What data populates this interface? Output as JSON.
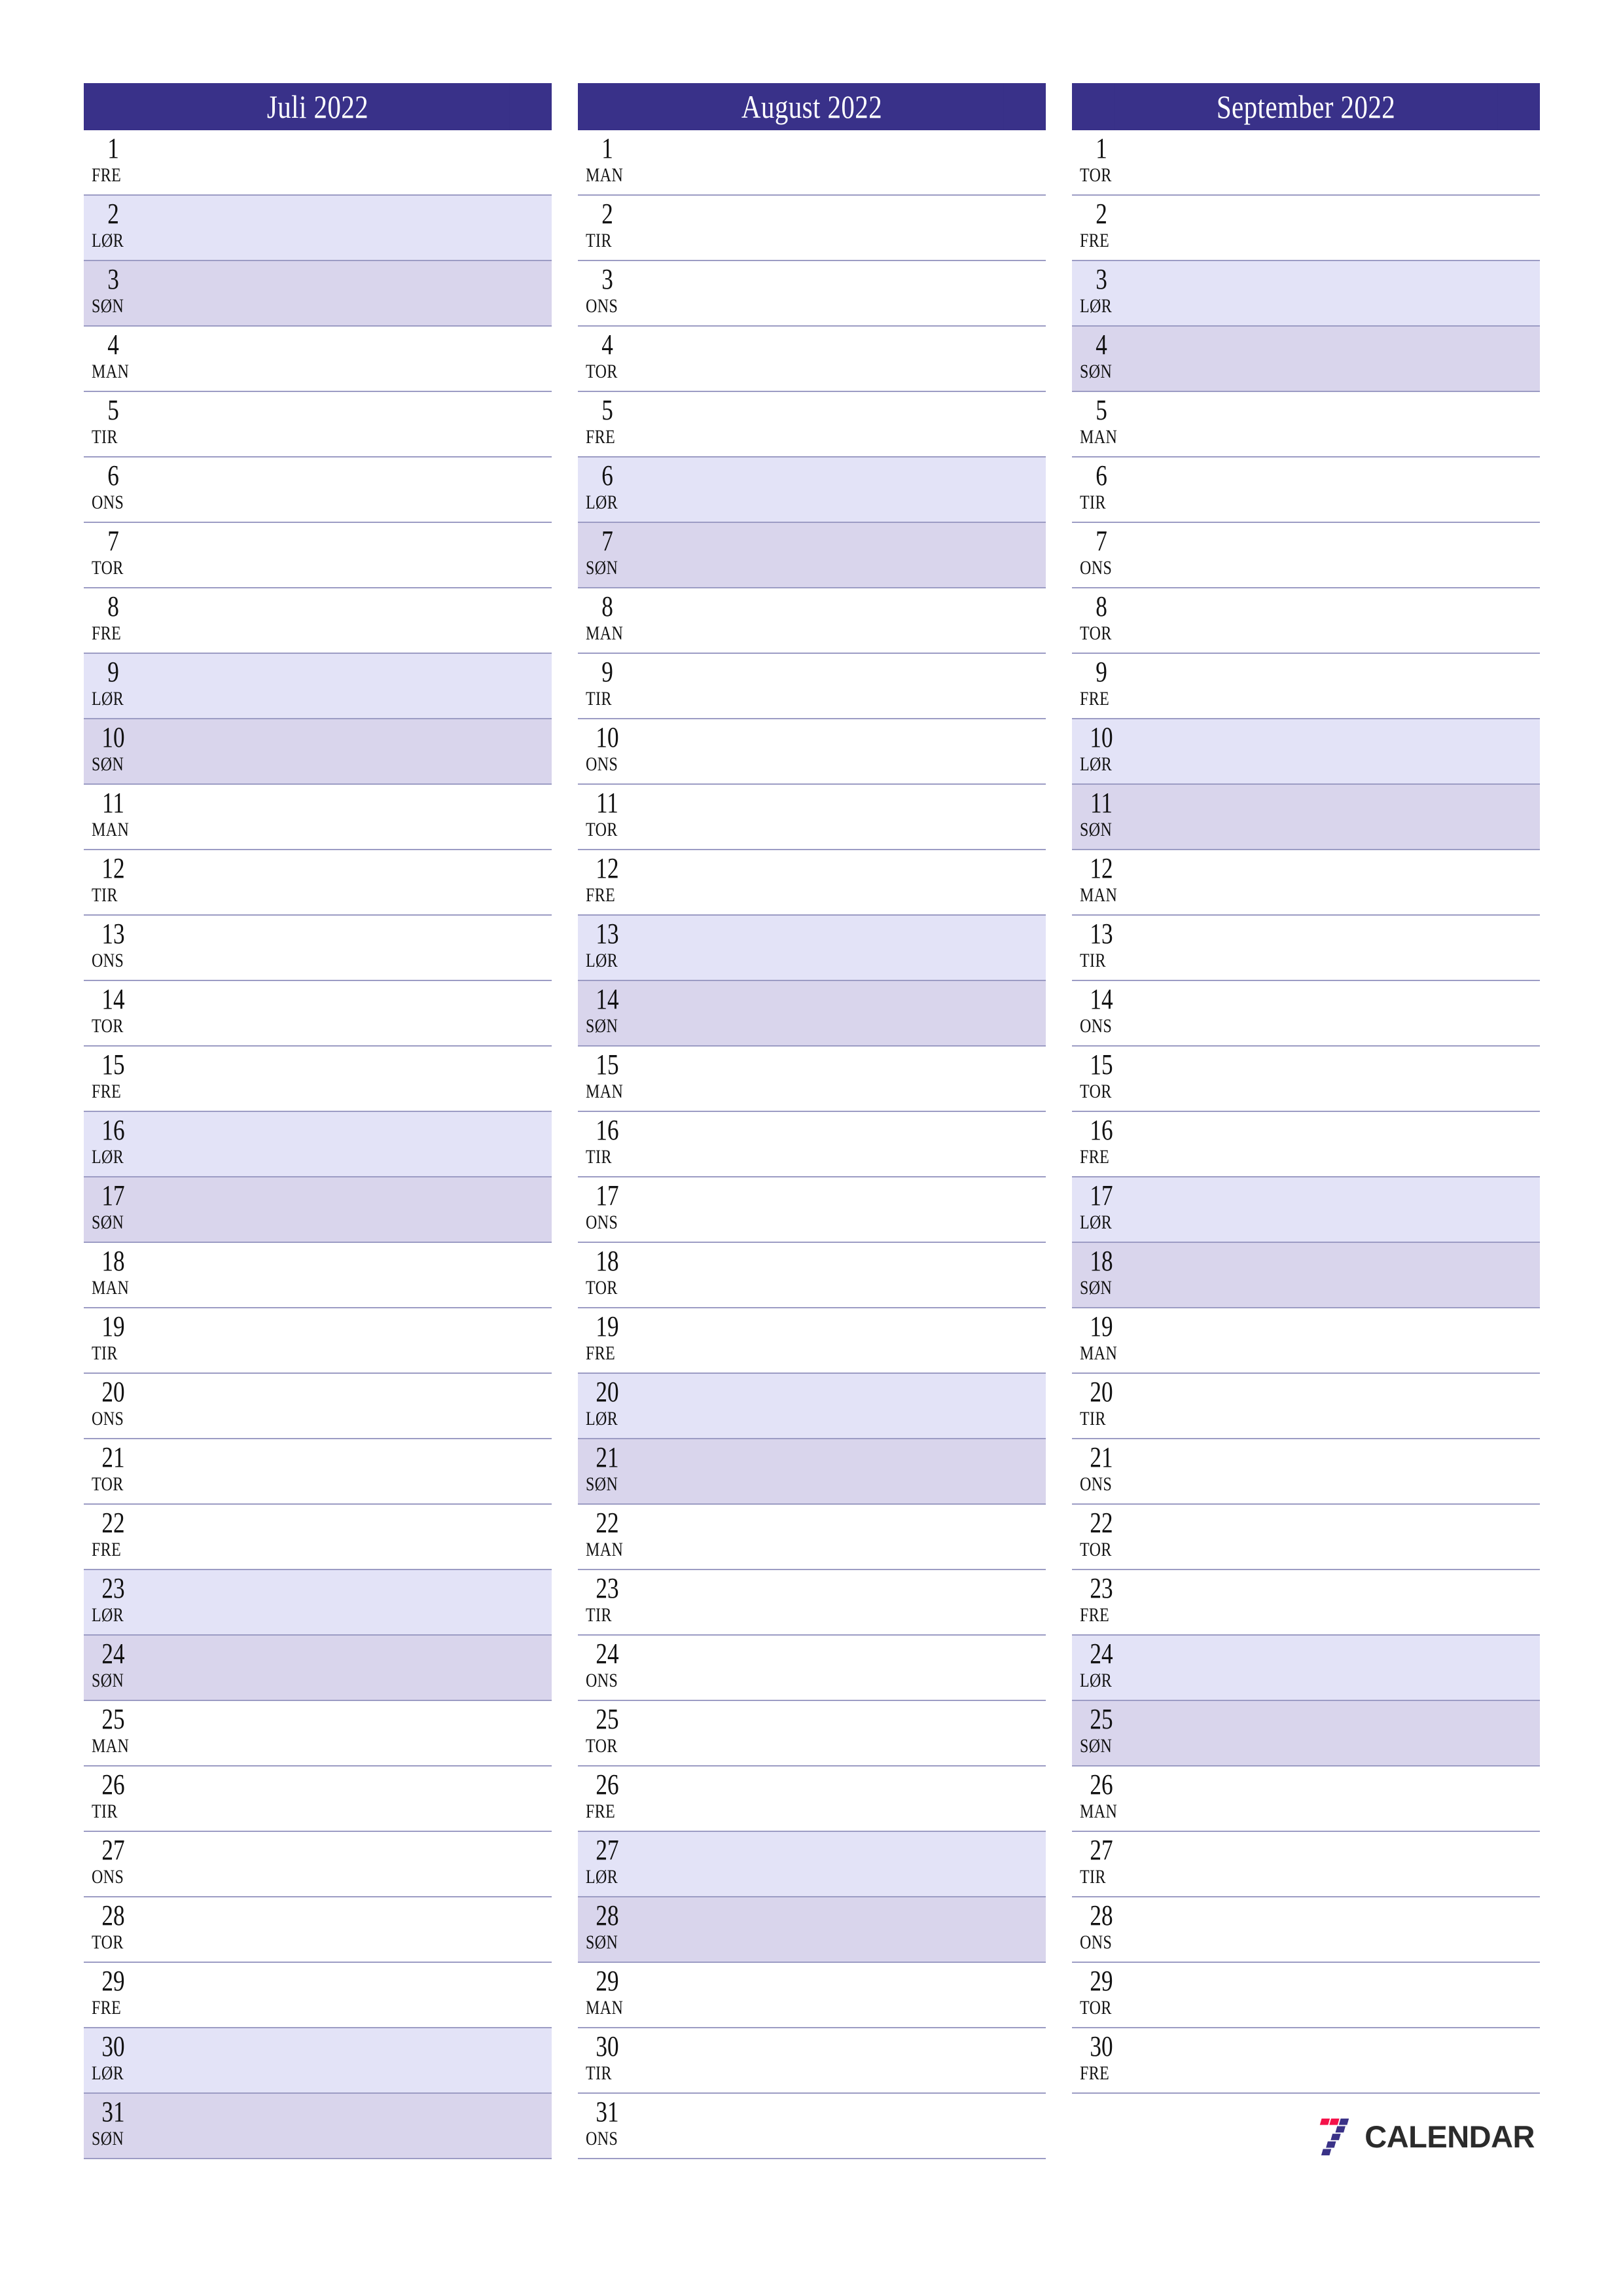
{
  "page": {
    "type": "quarterly-planner",
    "year": "2022",
    "locale": "no"
  },
  "theme": {
    "header_bg": "#393189",
    "header_text": "#ffffff",
    "saturday_bg": "#e3e3f7",
    "sunday_bg": "#d9d5ec",
    "row_border": "#9c9cc4",
    "day_text": "#111111",
    "logo_red": "#f4124a",
    "logo_blue": "#3a3287",
    "logo_word_color": "#2b2b2b"
  },
  "logo": {
    "mark_name": "seven-stripes-icon",
    "word": "CALENDAR"
  },
  "months": [
    {
      "title": "Juli 2022",
      "name": "Juli",
      "days": [
        {
          "num": "1",
          "abbr": "FRE",
          "kind": "weekday"
        },
        {
          "num": "2",
          "abbr": "LØR",
          "kind": "sat"
        },
        {
          "num": "3",
          "abbr": "SØN",
          "kind": "sun"
        },
        {
          "num": "4",
          "abbr": "MAN",
          "kind": "weekday"
        },
        {
          "num": "5",
          "abbr": "TIR",
          "kind": "weekday"
        },
        {
          "num": "6",
          "abbr": "ONS",
          "kind": "weekday"
        },
        {
          "num": "7",
          "abbr": "TOR",
          "kind": "weekday"
        },
        {
          "num": "8",
          "abbr": "FRE",
          "kind": "weekday"
        },
        {
          "num": "9",
          "abbr": "LØR",
          "kind": "sat"
        },
        {
          "num": "10",
          "abbr": "SØN",
          "kind": "sun"
        },
        {
          "num": "11",
          "abbr": "MAN",
          "kind": "weekday"
        },
        {
          "num": "12",
          "abbr": "TIR",
          "kind": "weekday"
        },
        {
          "num": "13",
          "abbr": "ONS",
          "kind": "weekday"
        },
        {
          "num": "14",
          "abbr": "TOR",
          "kind": "weekday"
        },
        {
          "num": "15",
          "abbr": "FRE",
          "kind": "weekday"
        },
        {
          "num": "16",
          "abbr": "LØR",
          "kind": "sat"
        },
        {
          "num": "17",
          "abbr": "SØN",
          "kind": "sun"
        },
        {
          "num": "18",
          "abbr": "MAN",
          "kind": "weekday"
        },
        {
          "num": "19",
          "abbr": "TIR",
          "kind": "weekday"
        },
        {
          "num": "20",
          "abbr": "ONS",
          "kind": "weekday"
        },
        {
          "num": "21",
          "abbr": "TOR",
          "kind": "weekday"
        },
        {
          "num": "22",
          "abbr": "FRE",
          "kind": "weekday"
        },
        {
          "num": "23",
          "abbr": "LØR",
          "kind": "sat"
        },
        {
          "num": "24",
          "abbr": "SØN",
          "kind": "sun"
        },
        {
          "num": "25",
          "abbr": "MAN",
          "kind": "weekday"
        },
        {
          "num": "26",
          "abbr": "TIR",
          "kind": "weekday"
        },
        {
          "num": "27",
          "abbr": "ONS",
          "kind": "weekday"
        },
        {
          "num": "28",
          "abbr": "TOR",
          "kind": "weekday"
        },
        {
          "num": "29",
          "abbr": "FRE",
          "kind": "weekday"
        },
        {
          "num": "30",
          "abbr": "LØR",
          "kind": "sat"
        },
        {
          "num": "31",
          "abbr": "SØN",
          "kind": "sun"
        }
      ],
      "show_logo": false
    },
    {
      "title": "August 2022",
      "name": "August",
      "days": [
        {
          "num": "1",
          "abbr": "MAN",
          "kind": "weekday"
        },
        {
          "num": "2",
          "abbr": "TIR",
          "kind": "weekday"
        },
        {
          "num": "3",
          "abbr": "ONS",
          "kind": "weekday"
        },
        {
          "num": "4",
          "abbr": "TOR",
          "kind": "weekday"
        },
        {
          "num": "5",
          "abbr": "FRE",
          "kind": "weekday"
        },
        {
          "num": "6",
          "abbr": "LØR",
          "kind": "sat"
        },
        {
          "num": "7",
          "abbr": "SØN",
          "kind": "sun"
        },
        {
          "num": "8",
          "abbr": "MAN",
          "kind": "weekday"
        },
        {
          "num": "9",
          "abbr": "TIR",
          "kind": "weekday"
        },
        {
          "num": "10",
          "abbr": "ONS",
          "kind": "weekday"
        },
        {
          "num": "11",
          "abbr": "TOR",
          "kind": "weekday"
        },
        {
          "num": "12",
          "abbr": "FRE",
          "kind": "weekday"
        },
        {
          "num": "13",
          "abbr": "LØR",
          "kind": "sat"
        },
        {
          "num": "14",
          "abbr": "SØN",
          "kind": "sun"
        },
        {
          "num": "15",
          "abbr": "MAN",
          "kind": "weekday"
        },
        {
          "num": "16",
          "abbr": "TIR",
          "kind": "weekday"
        },
        {
          "num": "17",
          "abbr": "ONS",
          "kind": "weekday"
        },
        {
          "num": "18",
          "abbr": "TOR",
          "kind": "weekday"
        },
        {
          "num": "19",
          "abbr": "FRE",
          "kind": "weekday"
        },
        {
          "num": "20",
          "abbr": "LØR",
          "kind": "sat"
        },
        {
          "num": "21",
          "abbr": "SØN",
          "kind": "sun"
        },
        {
          "num": "22",
          "abbr": "MAN",
          "kind": "weekday"
        },
        {
          "num": "23",
          "abbr": "TIR",
          "kind": "weekday"
        },
        {
          "num": "24",
          "abbr": "ONS",
          "kind": "weekday"
        },
        {
          "num": "25",
          "abbr": "TOR",
          "kind": "weekday"
        },
        {
          "num": "26",
          "abbr": "FRE",
          "kind": "weekday"
        },
        {
          "num": "27",
          "abbr": "LØR",
          "kind": "sat"
        },
        {
          "num": "28",
          "abbr": "SØN",
          "kind": "sun"
        },
        {
          "num": "29",
          "abbr": "MAN",
          "kind": "weekday"
        },
        {
          "num": "30",
          "abbr": "TIR",
          "kind": "weekday"
        },
        {
          "num": "31",
          "abbr": "ONS",
          "kind": "weekday"
        }
      ],
      "show_logo": false
    },
    {
      "title": "September 2022",
      "name": "September",
      "days": [
        {
          "num": "1",
          "abbr": "TOR",
          "kind": "weekday"
        },
        {
          "num": "2",
          "abbr": "FRE",
          "kind": "weekday"
        },
        {
          "num": "3",
          "abbr": "LØR",
          "kind": "sat"
        },
        {
          "num": "4",
          "abbr": "SØN",
          "kind": "sun"
        },
        {
          "num": "5",
          "abbr": "MAN",
          "kind": "weekday"
        },
        {
          "num": "6",
          "abbr": "TIR",
          "kind": "weekday"
        },
        {
          "num": "7",
          "abbr": "ONS",
          "kind": "weekday"
        },
        {
          "num": "8",
          "abbr": "TOR",
          "kind": "weekday"
        },
        {
          "num": "9",
          "abbr": "FRE",
          "kind": "weekday"
        },
        {
          "num": "10",
          "abbr": "LØR",
          "kind": "sat"
        },
        {
          "num": "11",
          "abbr": "SØN",
          "kind": "sun"
        },
        {
          "num": "12",
          "abbr": "MAN",
          "kind": "weekday"
        },
        {
          "num": "13",
          "abbr": "TIR",
          "kind": "weekday"
        },
        {
          "num": "14",
          "abbr": "ONS",
          "kind": "weekday"
        },
        {
          "num": "15",
          "abbr": "TOR",
          "kind": "weekday"
        },
        {
          "num": "16",
          "abbr": "FRE",
          "kind": "weekday"
        },
        {
          "num": "17",
          "abbr": "LØR",
          "kind": "sat"
        },
        {
          "num": "18",
          "abbr": "SØN",
          "kind": "sun"
        },
        {
          "num": "19",
          "abbr": "MAN",
          "kind": "weekday"
        },
        {
          "num": "20",
          "abbr": "TIR",
          "kind": "weekday"
        },
        {
          "num": "21",
          "abbr": "ONS",
          "kind": "weekday"
        },
        {
          "num": "22",
          "abbr": "TOR",
          "kind": "weekday"
        },
        {
          "num": "23",
          "abbr": "FRE",
          "kind": "weekday"
        },
        {
          "num": "24",
          "abbr": "LØR",
          "kind": "sat"
        },
        {
          "num": "25",
          "abbr": "SØN",
          "kind": "sun"
        },
        {
          "num": "26",
          "abbr": "MAN",
          "kind": "weekday"
        },
        {
          "num": "27",
          "abbr": "TIR",
          "kind": "weekday"
        },
        {
          "num": "28",
          "abbr": "ONS",
          "kind": "weekday"
        },
        {
          "num": "29",
          "abbr": "TOR",
          "kind": "weekday"
        },
        {
          "num": "30",
          "abbr": "FRE",
          "kind": "weekday"
        }
      ],
      "show_logo": true
    }
  ]
}
